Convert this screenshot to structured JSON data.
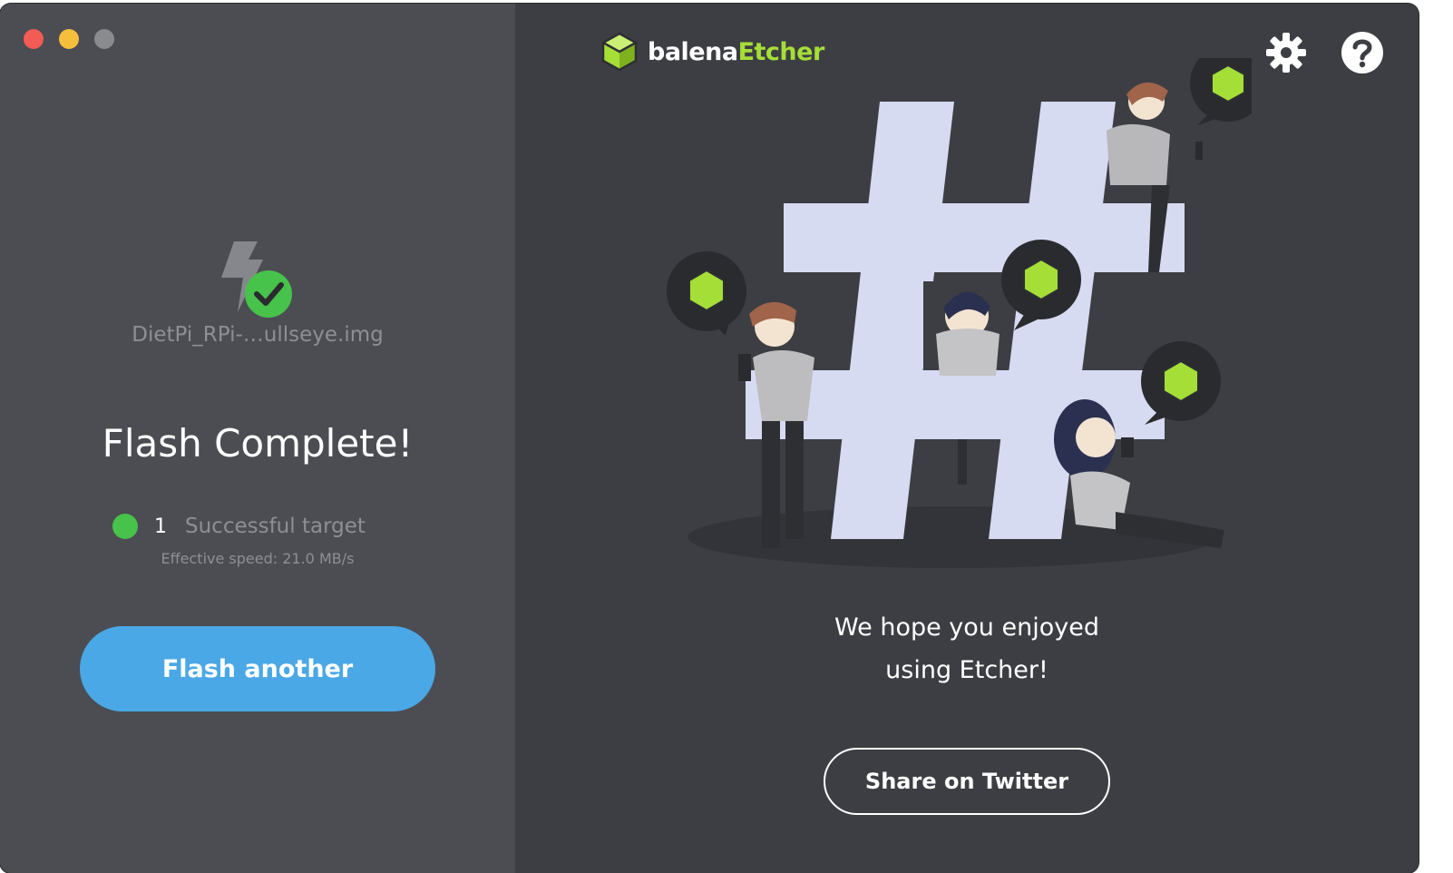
{
  "window": {
    "controls": [
      "close",
      "minimize",
      "maximize"
    ]
  },
  "header": {
    "brand_part1": "balena",
    "brand_part2": "Etcher",
    "logo_icon": "balena-cube-icon",
    "settings_icon": "gear-icon",
    "help_icon": "question-circle-icon"
  },
  "left": {
    "source_icon": "flash-success-icon",
    "filename": "DietPi_RPi-…ullseye.img",
    "title": "Flash Complete!",
    "targets": {
      "count": "1",
      "label": "Successful target",
      "status_color": "#47c24a"
    },
    "speed": "Effective speed: 21.0 MB/s",
    "button_label": "Flash another"
  },
  "right": {
    "illustration": "hashtag-community-illustration",
    "message_line1": "We hope you enjoyed",
    "message_line2": "using Etcher!",
    "share_label": "Share on Twitter"
  },
  "colors": {
    "accent_green": "#a5de37",
    "button_blue": "#4ba8e6",
    "left_bg": "#4b4d53",
    "right_bg": "#3d3e43"
  }
}
